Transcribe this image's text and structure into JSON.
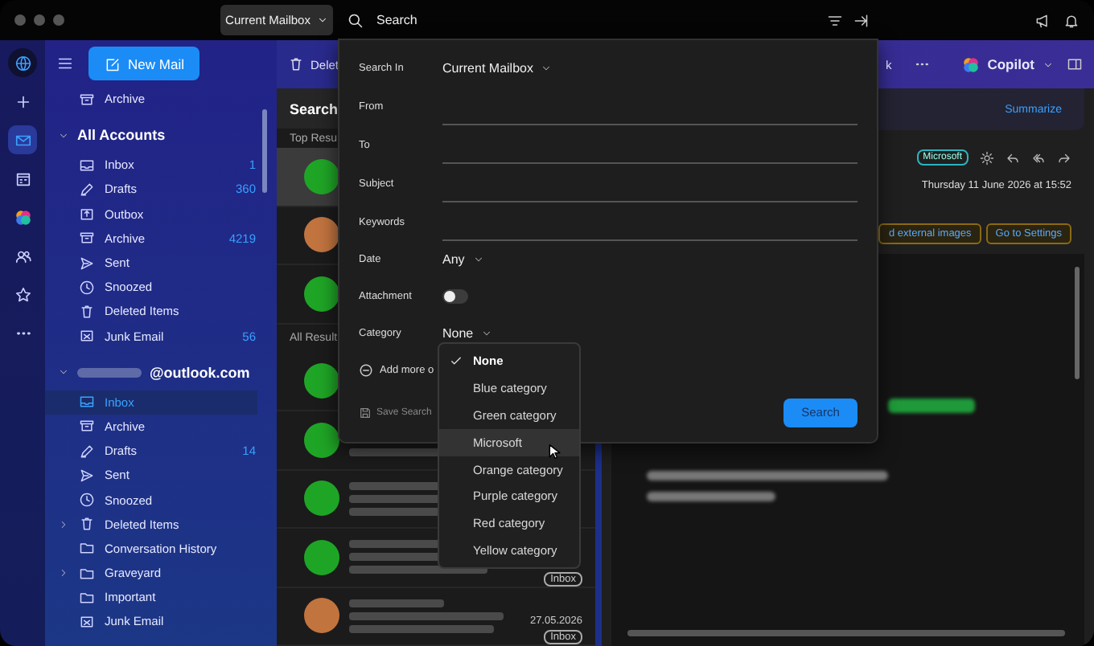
{
  "title_bar": {
    "mailbox_button": "Current Mailbox",
    "search": {
      "placeholder": "Search"
    }
  },
  "rail": [
    {
      "kind": "globe",
      "selected": false
    },
    {
      "kind": "add",
      "selected": false
    },
    {
      "kind": "mail",
      "selected": true
    },
    {
      "kind": "calendar",
      "selected": false
    },
    {
      "kind": "copilot",
      "selected": false
    },
    {
      "kind": "people",
      "selected": false
    },
    {
      "kind": "star",
      "selected": false
    },
    {
      "kind": "more",
      "selected": false
    }
  ],
  "sidebar": {
    "new_mail": "New Mail",
    "favorites": [
      {
        "name": "Archive",
        "kind": "archive",
        "selected": false,
        "expandable": false
      }
    ],
    "accounts": [
      {
        "title": "All Accounts",
        "name_hidden": false,
        "expanded": true,
        "folders": [
          {
            "name": "Inbox",
            "kind": "inbox",
            "count": "1",
            "selected": false,
            "expandable": false
          },
          {
            "name": "Drafts",
            "kind": "drafts",
            "count": "360",
            "selected": false,
            "expandable": false
          },
          {
            "name": "Outbox",
            "kind": "outbox",
            "selected": false,
            "expandable": false
          },
          {
            "name": "Archive",
            "kind": "archive",
            "count": "4219",
            "selected": false,
            "expandable": false
          },
          {
            "name": "Sent",
            "kind": "sent",
            "selected": false,
            "expandable": false
          },
          {
            "name": "Snoozed",
            "kind": "snoozed",
            "selected": false,
            "expandable": false
          },
          {
            "name": "Deleted Items",
            "kind": "deleted",
            "selected": false,
            "expandable": false
          },
          {
            "name": "Junk Email",
            "kind": "junk",
            "count": "56",
            "selected": false,
            "expandable": false
          }
        ]
      },
      {
        "title": "@outlook.com",
        "name_hidden": true,
        "expanded": true,
        "folders": [
          {
            "name": "Inbox",
            "kind": "inbox",
            "selected": true,
            "expandable": false
          },
          {
            "name": "Archive",
            "kind": "archive",
            "selected": false,
            "expandable": false
          },
          {
            "name": "Drafts",
            "kind": "drafts",
            "count": "14",
            "selected": false,
            "expandable": false
          },
          {
            "name": "Sent",
            "kind": "sent",
            "selected": false,
            "expandable": false
          },
          {
            "name": "Snoozed",
            "kind": "snoozed",
            "selected": false,
            "expandable": false
          },
          {
            "name": "Deleted Items",
            "kind": "deleted",
            "selected": false,
            "expandable": true
          },
          {
            "name": "Conversation History",
            "kind": "folder",
            "selected": false,
            "expandable": false
          },
          {
            "name": "Graveyard",
            "kind": "folder",
            "selected": false,
            "expandable": true
          },
          {
            "name": "Important",
            "kind": "folder",
            "selected": false,
            "expandable": false
          },
          {
            "name": "Junk Email",
            "kind": "junk",
            "selected": false,
            "expandable": false
          }
        ]
      }
    ]
  },
  "toolbar": {
    "delete": "Delet",
    "partial_button": "k",
    "copilot": "Copilot"
  },
  "message_list": {
    "title": "Search",
    "sections": [
      {
        "label": "Top Resu",
        "messages": [
          {
            "color": "#1fa526",
            "selected": true
          },
          {
            "color": "#c2743f",
            "selected": false
          },
          {
            "color": "#1fa526",
            "selected": false
          }
        ]
      },
      {
        "label": "All Result",
        "messages": [
          {
            "color": "#1fa526",
            "selected": false
          },
          {
            "color": "#1fa526",
            "selected": false
          },
          {
            "color": "#1fa526",
            "selected": false
          },
          {
            "color": "#1fa526",
            "selected": false,
            "badge": "Inbox"
          },
          {
            "color": "#c2743f",
            "selected": false,
            "date": "27.05.2026",
            "badge": "Inbox"
          }
        ]
      }
    ]
  },
  "reading_pane": {
    "summarize": "Summarize",
    "category": "Microsoft",
    "date": "Thursday 11 June 2026 at 15:52",
    "banner_buttons": [
      "d external images",
      "Go to Settings"
    ]
  },
  "search_panel": {
    "fields": [
      {
        "kind": "select",
        "label": "Search In",
        "value": "Current Mailbox"
      },
      {
        "kind": "text",
        "label": "From"
      },
      {
        "kind": "text",
        "label": "To"
      },
      {
        "kind": "text",
        "label": "Subject"
      },
      {
        "kind": "text",
        "label": "Keywords"
      },
      {
        "kind": "select",
        "label": "Date",
        "value": "Any"
      },
      {
        "kind": "toggle",
        "label": "Attachment",
        "on": false
      },
      {
        "kind": "select",
        "label": "Category",
        "value": "None"
      }
    ],
    "add_more": "Add more o",
    "save_search": "Save Search",
    "search_button": "Search"
  },
  "category_menu": {
    "items": [
      {
        "label": "None",
        "selected": true,
        "hovered": false
      },
      {
        "label": "Blue category",
        "selected": false,
        "hovered": false
      },
      {
        "label": "Green category",
        "selected": false,
        "hovered": false
      },
      {
        "label": "Microsoft",
        "selected": false,
        "hovered": true
      },
      {
        "label": "Orange category",
        "selected": false,
        "hovered": false
      },
      {
        "label": "Purple category",
        "selected": false,
        "hovered": false
      },
      {
        "label": "Red category",
        "selected": false,
        "hovered": false
      },
      {
        "label": "Yellow category",
        "selected": false,
        "hovered": false
      }
    ]
  }
}
